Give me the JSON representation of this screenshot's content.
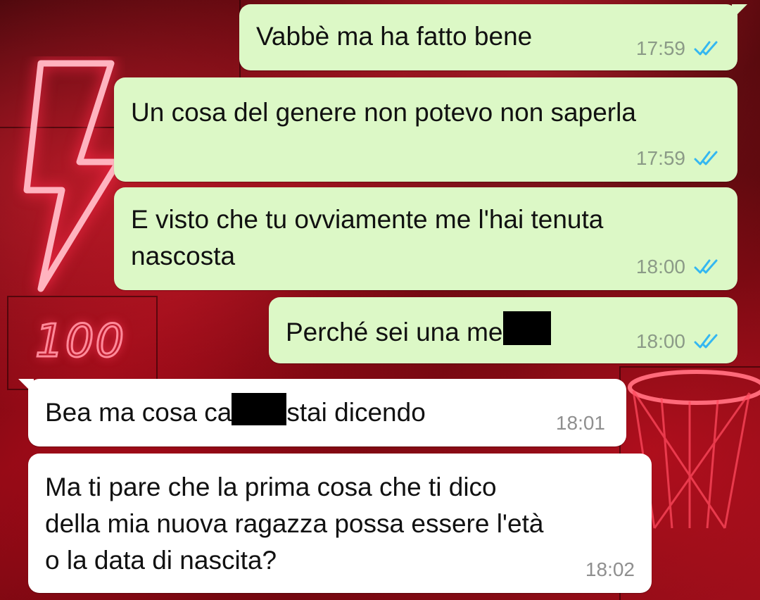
{
  "wallpaper": {
    "decor_text": "100",
    "colors": {
      "neon": "#ff2a3c",
      "dark": "#3a0508"
    }
  },
  "messages": [
    {
      "direction": "outgoing",
      "parts": [
        "Vabbè ma ha fatto bene"
      ],
      "time": "17:59",
      "status": "read"
    },
    {
      "direction": "outgoing",
      "parts": [
        "Un cosa del genere non potevo non saperla"
      ],
      "time": "17:59",
      "status": "read"
    },
    {
      "direction": "outgoing",
      "parts": [
        "E visto che tu ovviamente me l'hai tenuta",
        "nascosta"
      ],
      "time": "18:00",
      "status": "read"
    },
    {
      "direction": "outgoing",
      "parts": [
        "Perché sei una me"
      ],
      "time": "18:00",
      "status": "read",
      "redacted": true
    },
    {
      "direction": "incoming",
      "parts": [
        "Bea ma cosa ca",
        "stai dicendo"
      ],
      "time": "18:01",
      "redacted": true
    },
    {
      "direction": "incoming",
      "parts": [
        "Ma ti pare che la prima cosa che ti dico",
        "della mia nuova ragazza possa essere l'età",
        "o la data di nascita?"
      ],
      "time": "18:02"
    }
  ],
  "colors": {
    "outgoing_bubble": "#dcf8c6",
    "incoming_bubble": "#ffffff",
    "read_tick": "#34b7f1"
  },
  "icons": {
    "read_receipt": "double-check-icon"
  }
}
